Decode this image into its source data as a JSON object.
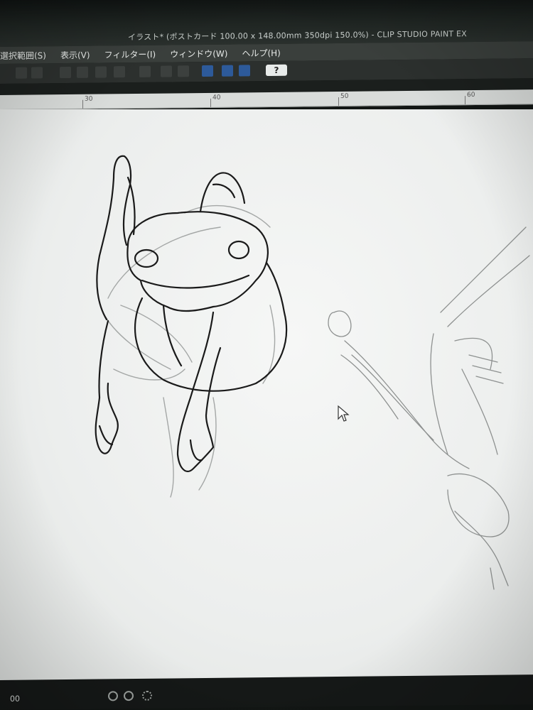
{
  "window": {
    "title": "イラスト* (ポストカード 100.00 x 148.00mm 350dpi 150.0%) - CLIP STUDIO PAINT EX"
  },
  "menu": {
    "items": [
      {
        "label": "選択範囲(S)"
      },
      {
        "label": "表示(V)"
      },
      {
        "label": "フィルター(I)"
      },
      {
        "label": "ウィンドウ(W)"
      },
      {
        "label": "ヘルプ(H)"
      }
    ]
  },
  "toolbar": {
    "help_label": "?"
  },
  "ruler": {
    "labels": [
      "30",
      "40",
      "50",
      "60"
    ]
  },
  "status": {
    "zoom_label": "00"
  },
  "icons": {
    "cursor": "mouse-pointer-icon",
    "help": "question-icon",
    "undo": "undo-icon",
    "redo": "redo-icon"
  },
  "colors": {
    "ink": "#1a1a1a",
    "sketch": "#9a9d9c",
    "accent_blue": "#2d5a9a"
  }
}
